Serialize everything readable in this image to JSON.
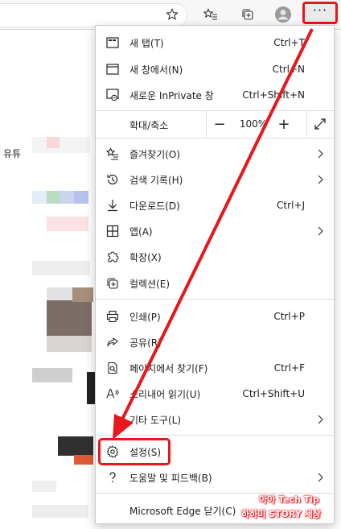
{
  "toolbar": {
    "icons": [
      "favorite-star-icon",
      "favorites-icon",
      "collections-icon",
      "profile-icon"
    ],
    "more_label": "···"
  },
  "page": {
    "partial_text": "유튜"
  },
  "menu": {
    "new_tab": {
      "label": "새 탭(T)",
      "shortcut": "Ctrl+T"
    },
    "new_window": {
      "label": "새 창에서(N)",
      "shortcut": "Ctrl+N"
    },
    "new_inprivate": {
      "label": "새로운 InPrivate 창",
      "shortcut": "Ctrl+Shift+N"
    },
    "zoom": {
      "label": "확대/축소",
      "minus": "−",
      "value": "100%",
      "plus": "+"
    },
    "favorites": {
      "label": "즐겨찾기(O)"
    },
    "history": {
      "label": "검색 기록(H)"
    },
    "downloads": {
      "label": "다운로드(D)",
      "shortcut": "Ctrl+J"
    },
    "apps": {
      "label": "앱(A)"
    },
    "extensions": {
      "label": "확장(X)"
    },
    "collections": {
      "label": "컬렉션(E)"
    },
    "print": {
      "label": "인쇄(P)",
      "shortcut": "Ctrl+P"
    },
    "share": {
      "label": "공유(R)"
    },
    "find": {
      "label": "페이지에서 찾기(F)",
      "shortcut": "Ctrl+F"
    },
    "read_aloud": {
      "label": "소리내어 읽기(U)",
      "shortcut": "Ctrl+Shift+U"
    },
    "more_tools": {
      "label": "기타 도구(L)"
    },
    "settings": {
      "label": "설정(S)"
    },
    "help": {
      "label": "도움말 및 피드백(B)"
    },
    "close_edge": {
      "label": "Microsoft Edge 닫기(C)"
    }
  },
  "watermark": {
    "line1": "아아 Tech Tip",
    "line2": "하하미 STORY 세상"
  },
  "colors": {
    "highlight": "#e8161d",
    "menu_bg": "#ffffff",
    "toolbar_bg": "#f7f7f7"
  }
}
